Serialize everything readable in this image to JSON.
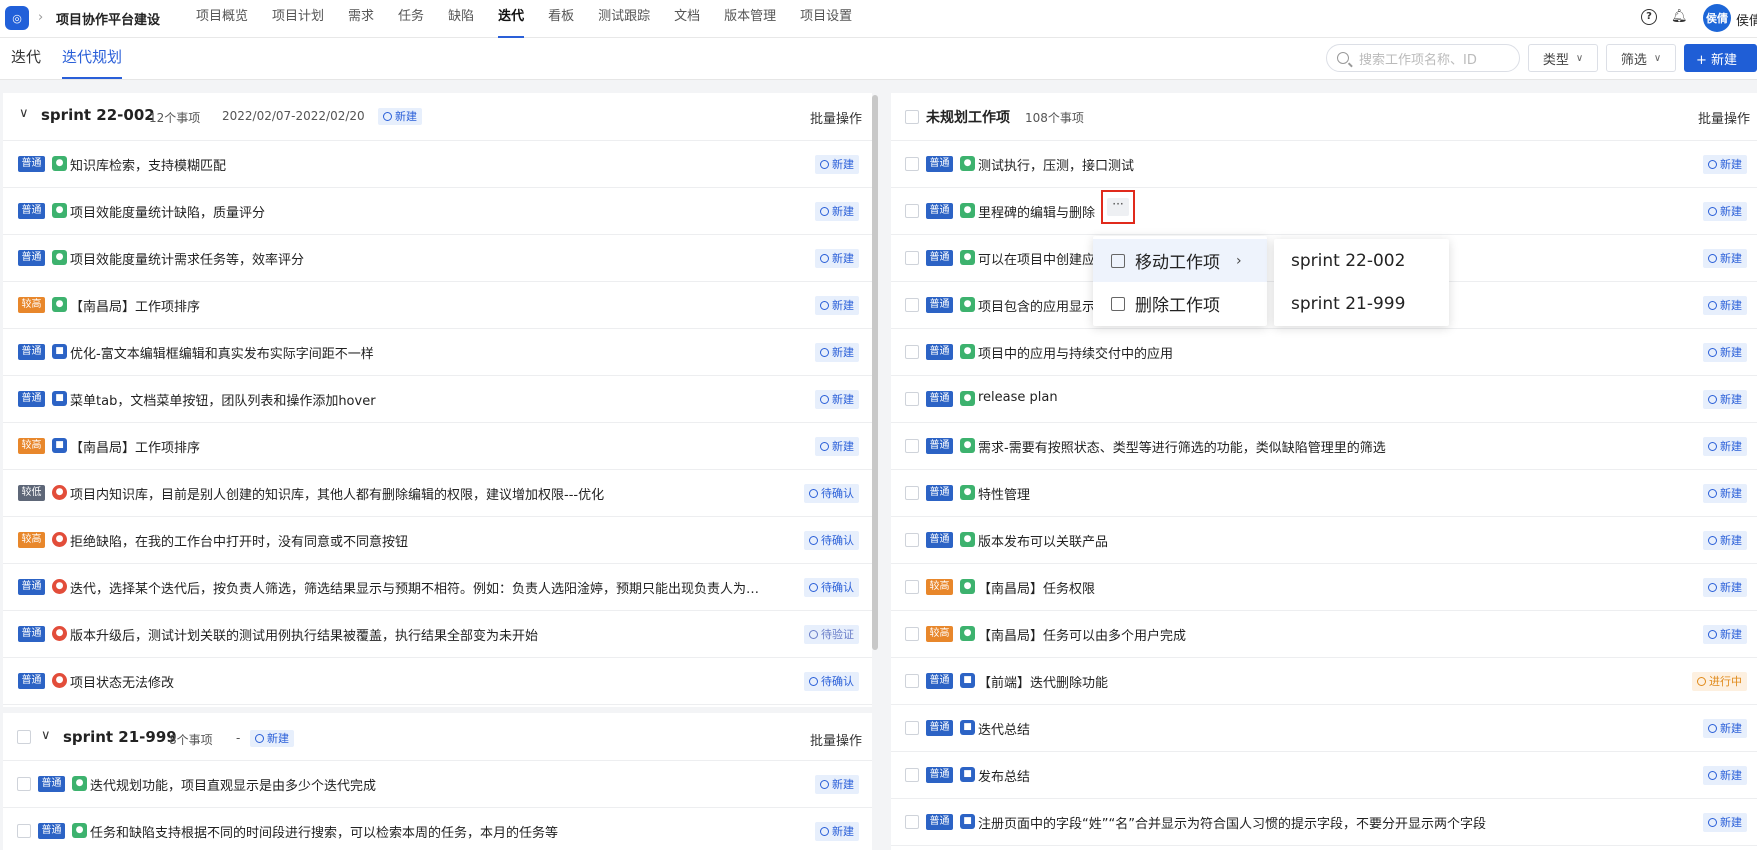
{
  "header": {
    "logo_text": "◎",
    "project_title": "项目协作平台建设",
    "menu": [
      "项目概览",
      "项目计划",
      "需求",
      "任务",
      "缺陷",
      "迭代",
      "看板",
      "测试跟踪",
      "文档",
      "版本管理",
      "项目设置"
    ],
    "active_menu": "迭代",
    "avatar_text": "侯倩",
    "user_name": "侯倩"
  },
  "subnav": {
    "tabs": [
      "迭代",
      "迭代规划"
    ],
    "active_tab": "迭代规划",
    "search_placeholder": "搜索工作项名称、ID",
    "type_label": "类型",
    "filter_label": "筛选",
    "new_label": "+ 新建"
  },
  "left": {
    "group1": {
      "name": "sprint 22-002",
      "count": "12个事项",
      "range": "2022/02/07-2022/02/20",
      "status": "新建",
      "batch": "批量操作"
    },
    "rows": [
      {
        "priority": "普通",
        "ptype": "normal",
        "type": "req",
        "title": "知识库检索，支持模糊匹配",
        "status": "新建",
        "stype": "new"
      },
      {
        "priority": "普通",
        "ptype": "normal",
        "type": "req",
        "title": "项目效能度量统计缺陷，质量评分",
        "status": "新建",
        "stype": "new"
      },
      {
        "priority": "普通",
        "ptype": "normal",
        "type": "req",
        "title": "项目效能度量统计需求任务等，效率评分",
        "status": "新建",
        "stype": "new"
      },
      {
        "priority": "较高",
        "ptype": "high",
        "type": "req",
        "title": "【南昌局】工作项排序",
        "status": "新建",
        "stype": "new"
      },
      {
        "priority": "普通",
        "ptype": "normal",
        "type": "task",
        "title": "优化-富文本编辑框编辑和真实发布实际字间距不一样",
        "status": "新建",
        "stype": "new"
      },
      {
        "priority": "普通",
        "ptype": "normal",
        "type": "task",
        "title": "菜单tab，文档菜单按钮，团队列表和操作添加hover",
        "status": "新建",
        "stype": "new"
      },
      {
        "priority": "较高",
        "ptype": "high",
        "type": "task",
        "title": "【南昌局】工作项排序",
        "status": "新建",
        "stype": "new"
      },
      {
        "priority": "较低",
        "ptype": "low",
        "type": "bug",
        "title": "项目内知识库，目前是别人创建的知识库，其他人都有删除编辑的权限，建议增加权限---优化",
        "status": "待确认",
        "stype": "confirm"
      },
      {
        "priority": "较高",
        "ptype": "high",
        "type": "bug",
        "title": "拒绝缺陷，在我的工作台中打开时，没有同意或不同意按钮",
        "status": "待确认",
        "stype": "confirm"
      },
      {
        "priority": "普通",
        "ptype": "normal",
        "type": "bug",
        "title": "迭代，选择某个迭代后，按负责人筛选，筛选结果显示与预期不相符。例如：负责人选阳淦婷，预期只能出现负责人为她，实际...",
        "status": "待确认",
        "stype": "confirm"
      },
      {
        "priority": "普通",
        "ptype": "normal",
        "type": "bug",
        "title": "版本升级后，测试计划关联的测试用例执行结果被覆盖，执行结果全部变为未开始",
        "status": "待验证",
        "stype": "verify"
      },
      {
        "priority": "普通",
        "ptype": "normal",
        "type": "bug",
        "title": "项目状态无法修改",
        "status": "待确认",
        "stype": "confirm"
      }
    ],
    "group2": {
      "name": "sprint 21-999",
      "count": "8个事项",
      "range": "-",
      "status": "新建",
      "batch": "批量操作"
    },
    "rows2": [
      {
        "priority": "普通",
        "ptype": "normal",
        "type": "req",
        "title": "迭代规划功能，项目直观显示是由多少个迭代完成",
        "status": "新建",
        "stype": "new"
      },
      {
        "priority": "普通",
        "ptype": "normal",
        "type": "req",
        "title": "任务和缺陷支持根据不同的时间段进行搜索，可以检索本周的任务，本月的任务等",
        "status": "新建",
        "stype": "new"
      }
    ]
  },
  "right": {
    "title": "未规划工作项",
    "count": "108个事项",
    "batch": "批量操作",
    "rows": [
      {
        "priority": "普通",
        "ptype": "normal",
        "type": "req",
        "title": "测试执行，压测，接口测试",
        "status": "新建",
        "stype": "new"
      },
      {
        "priority": "普通",
        "ptype": "normal",
        "type": "req",
        "title": "里程碑的编辑与删除",
        "status": "新建",
        "stype": "new"
      },
      {
        "priority": "普通",
        "ptype": "normal",
        "type": "req",
        "title": "可以在项目中创建应",
        "status": "新建",
        "stype": "new"
      },
      {
        "priority": "普通",
        "ptype": "normal",
        "type": "req",
        "title": "项目包含的应用显示",
        "status": "新建",
        "stype": "new"
      },
      {
        "priority": "普通",
        "ptype": "normal",
        "type": "req",
        "title": "项目中的应用与持续交付中的应用",
        "status": "新建",
        "stype": "new"
      },
      {
        "priority": "普通",
        "ptype": "normal",
        "type": "req",
        "title": "release plan",
        "status": "新建",
        "stype": "new"
      },
      {
        "priority": "普通",
        "ptype": "normal",
        "type": "req",
        "title": "需求-需要有按照状态、类型等进行筛选的功能，类似缺陷管理里的筛选",
        "status": "新建",
        "stype": "new"
      },
      {
        "priority": "普通",
        "ptype": "normal",
        "type": "req",
        "title": "特性管理",
        "status": "新建",
        "stype": "new"
      },
      {
        "priority": "普通",
        "ptype": "normal",
        "type": "req",
        "title": "版本发布可以关联产品",
        "status": "新建",
        "stype": "new"
      },
      {
        "priority": "较高",
        "ptype": "high",
        "type": "req",
        "title": "【南昌局】任务权限",
        "status": "新建",
        "stype": "new"
      },
      {
        "priority": "较高",
        "ptype": "high",
        "type": "req",
        "title": "【南昌局】任务可以由多个用户完成",
        "status": "新建",
        "stype": "new"
      },
      {
        "priority": "普通",
        "ptype": "normal",
        "type": "task",
        "title": "【前端】迭代删除功能",
        "status": "进行中",
        "stype": "doing"
      },
      {
        "priority": "普通",
        "ptype": "normal",
        "type": "task",
        "title": "迭代总结",
        "status": "新建",
        "stype": "new"
      },
      {
        "priority": "普通",
        "ptype": "normal",
        "type": "task",
        "title": "发布总结",
        "status": "新建",
        "stype": "new"
      },
      {
        "priority": "普通",
        "ptype": "normal",
        "type": "task",
        "title": "注册页面中的字段“姓”“名”合并显示为符合国人习惯的提示字段，不要分开显示两个字段",
        "status": "新建",
        "stype": "new"
      }
    ]
  },
  "context_menu": {
    "more_label": "···",
    "items": [
      "移动工作项",
      "删除工作项"
    ],
    "submenu": [
      "sprint 22-002",
      "sprint 21-999"
    ]
  }
}
